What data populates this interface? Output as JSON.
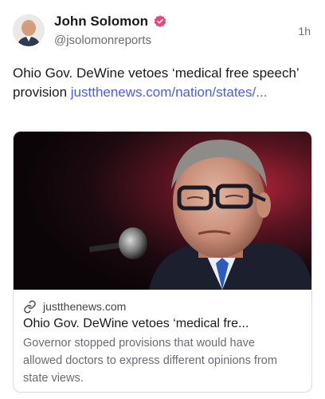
{
  "post": {
    "author_name": "John Solomon",
    "author_handle": "@jsolomonreports",
    "timestamp": "1h",
    "text_before_link": "Ohio Gov. DeWine vetoes ‘medical free speech’ provision ",
    "link_text": "justthenews.com/nation/states/...",
    "verified_icon": "verified-badge-icon",
    "verified_color": "#e8457c"
  },
  "link_card": {
    "domain": "justthenews.com",
    "title": "Ohio Gov. DeWine vetoes ‘medical fre...",
    "description": "Governor stopped provisions that would have allowed doctors to express different opinions from state views.",
    "link_icon": "link-icon"
  },
  "colors": {
    "link": "#4a5fe0",
    "secondary_text": "#6b6b73",
    "border": "#dcdcdf"
  }
}
